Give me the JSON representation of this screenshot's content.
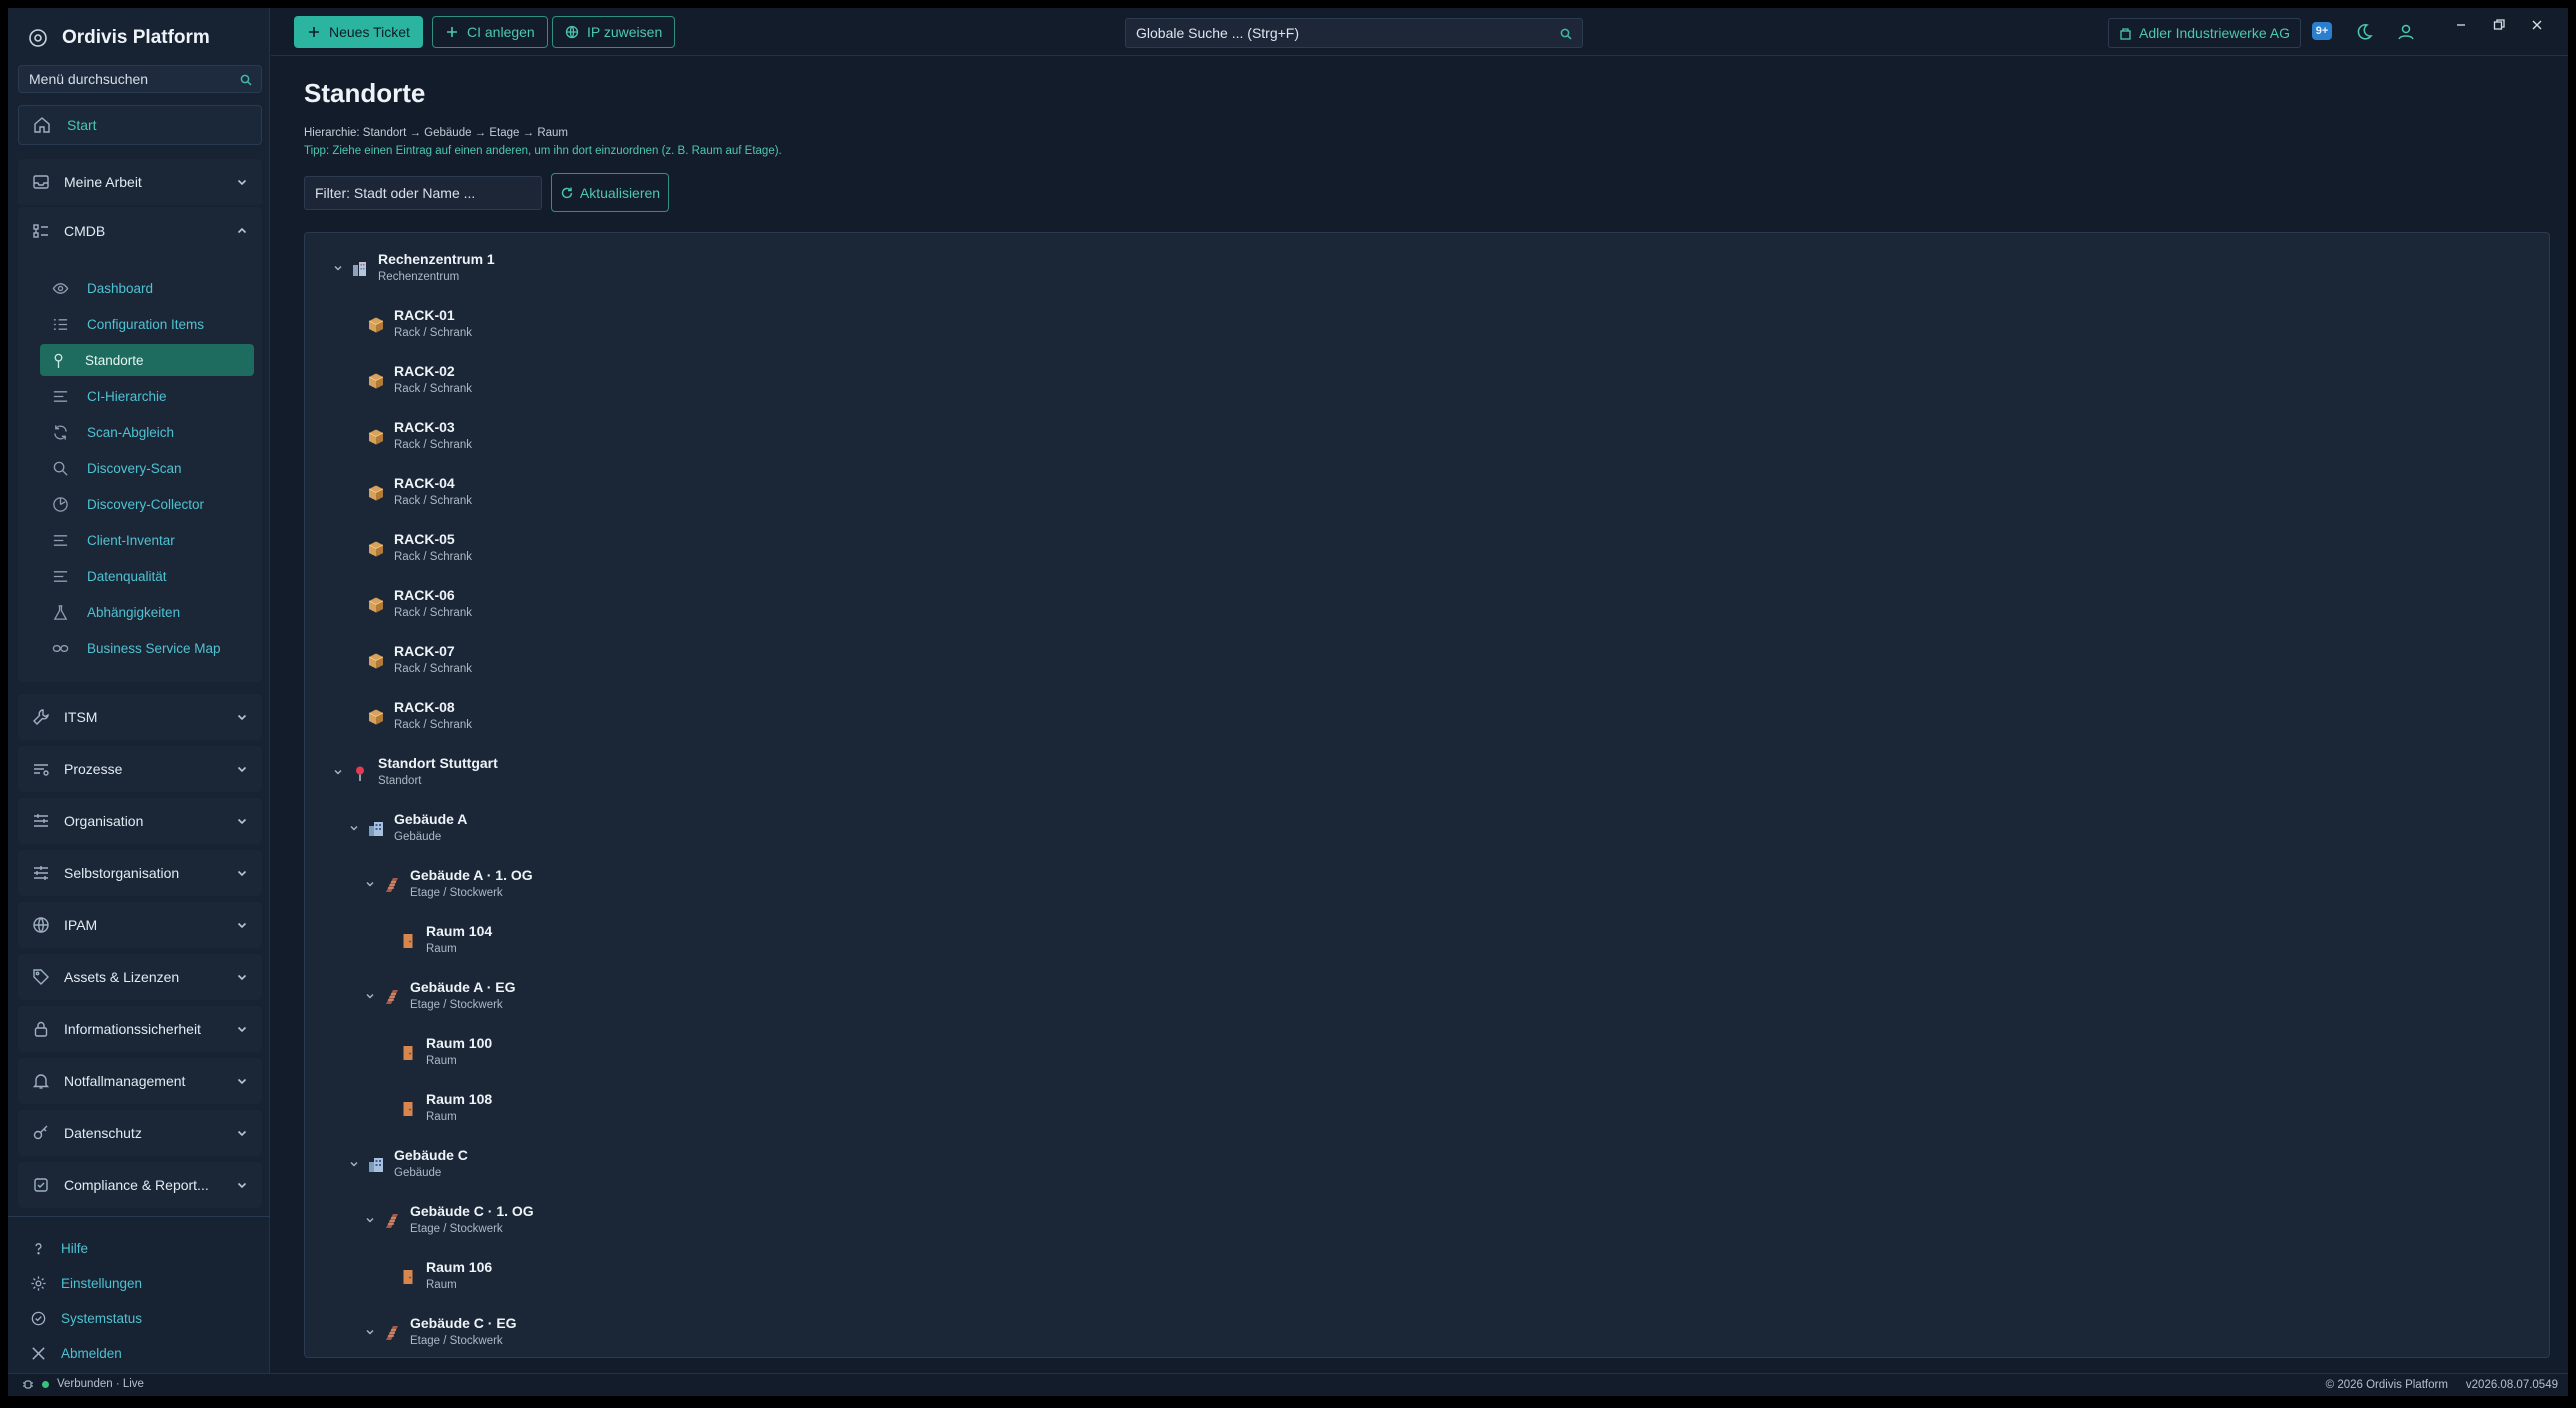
{
  "app": {
    "title": "Ordivis Platform"
  },
  "sidebar": {
    "search_placeholder": "Menü durchsuchen",
    "start": "Start",
    "groups_top": [
      {
        "label": "Meine Arbeit"
      }
    ],
    "cmdb": {
      "label": "CMDB",
      "items": [
        {
          "label": "Dashboard",
          "icon": "eye-icon"
        },
        {
          "label": "Configuration Items",
          "icon": "list-icon"
        },
        {
          "label": "Standorte",
          "icon": "pin-icon",
          "active": true
        },
        {
          "label": "CI-Hierarchie",
          "icon": "lines-icon"
        },
        {
          "label": "Scan-Abgleich",
          "icon": "sync-icon"
        },
        {
          "label": "Discovery-Scan",
          "icon": "search-icon"
        },
        {
          "label": "Discovery-Collector",
          "icon": "radar-icon"
        },
        {
          "label": "Client-Inventar",
          "icon": "lines-icon"
        },
        {
          "label": "Datenqualität",
          "icon": "lines-icon"
        },
        {
          "label": "Abhängigkeiten",
          "icon": "flask-icon"
        },
        {
          "label": "Business Service Map",
          "icon": "link-icon"
        }
      ]
    },
    "groups_bottom": [
      {
        "label": "ITSM",
        "icon": "wrench-icon"
      },
      {
        "label": "Prozesse",
        "icon": "process-icon"
      },
      {
        "label": "Organisation",
        "icon": "org-icon"
      },
      {
        "label": "Selbstorganisation",
        "icon": "kanban-icon"
      },
      {
        "label": "IPAM",
        "icon": "globe-icon"
      },
      {
        "label": "Assets & Lizenzen",
        "icon": "tag-icon"
      },
      {
        "label": "Informationssicherheit",
        "icon": "lock-icon"
      },
      {
        "label": "Notfallmanagement",
        "icon": "bell-icon"
      },
      {
        "label": "Datenschutz",
        "icon": "key-icon"
      },
      {
        "label": "Compliance & Report...",
        "icon": "checkshield-icon"
      }
    ],
    "footer": [
      {
        "label": "Hilfe",
        "icon": "help-icon"
      },
      {
        "label": "Einstellungen",
        "icon": "gear-icon"
      },
      {
        "label": "Systemstatus",
        "icon": "status-icon"
      },
      {
        "label": "Abmelden",
        "icon": "close-icon"
      }
    ]
  },
  "topbar": {
    "new_ticket": "Neues Ticket",
    "ci_create": "CI anlegen",
    "ip_assign": "IP zuweisen",
    "search_placeholder": "Globale Suche ... (Strg+F)",
    "tenant": "Adler Industriewerke AG",
    "badge": "9+"
  },
  "page": {
    "title": "Standorte",
    "hierarchy": "Hierarchie: Standort → Gebäude → Etage → Raum",
    "tip": "Tipp: Ziehe einen Eintrag auf einen anderen, um ihn dort einzuordnen (z. B. Raum auf Etage).",
    "filter_placeholder": "Filter: Stadt oder Name ...",
    "refresh": "Aktualisieren"
  },
  "tree": [
    {
      "title": "Rechenzentrum 1",
      "subtitle": "Rechenzentrum",
      "level": 0,
      "kind": "datacenter",
      "expanded": true
    },
    {
      "title": "RACK-01",
      "subtitle": "Rack / Schrank",
      "level": 1,
      "kind": "rack"
    },
    {
      "title": "RACK-02",
      "subtitle": "Rack / Schrank",
      "level": 1,
      "kind": "rack"
    },
    {
      "title": "RACK-03",
      "subtitle": "Rack / Schrank",
      "level": 1,
      "kind": "rack"
    },
    {
      "title": "RACK-04",
      "subtitle": "Rack / Schrank",
      "level": 1,
      "kind": "rack"
    },
    {
      "title": "RACK-05",
      "subtitle": "Rack / Schrank",
      "level": 1,
      "kind": "rack"
    },
    {
      "title": "RACK-06",
      "subtitle": "Rack / Schrank",
      "level": 1,
      "kind": "rack"
    },
    {
      "title": "RACK-07",
      "subtitle": "Rack / Schrank",
      "level": 1,
      "kind": "rack"
    },
    {
      "title": "RACK-08",
      "subtitle": "Rack / Schrank",
      "level": 1,
      "kind": "rack"
    },
    {
      "title": "Standort Stuttgart",
      "subtitle": "Standort",
      "level": 0,
      "kind": "site",
      "expanded": true
    },
    {
      "title": "Gebäude A",
      "subtitle": "Gebäude",
      "level": 1,
      "kind": "building",
      "expanded": true
    },
    {
      "title": "Gebäude A · 1. OG",
      "subtitle": "Etage / Stockwerk",
      "level": 2,
      "kind": "floor",
      "expanded": true
    },
    {
      "title": "Raum 104",
      "subtitle": "Raum",
      "level": 3,
      "kind": "room"
    },
    {
      "title": "Gebäude A · EG",
      "subtitle": "Etage / Stockwerk",
      "level": 2,
      "kind": "floor",
      "expanded": true
    },
    {
      "title": "Raum 100",
      "subtitle": "Raum",
      "level": 3,
      "kind": "room"
    },
    {
      "title": "Raum 108",
      "subtitle": "Raum",
      "level": 3,
      "kind": "room"
    },
    {
      "title": "Gebäude C",
      "subtitle": "Gebäude",
      "level": 1,
      "kind": "building",
      "expanded": true
    },
    {
      "title": "Gebäude C · 1. OG",
      "subtitle": "Etage / Stockwerk",
      "level": 2,
      "kind": "floor",
      "expanded": true
    },
    {
      "title": "Raum 106",
      "subtitle": "Raum",
      "level": 3,
      "kind": "room"
    },
    {
      "title": "Gebäude C · EG",
      "subtitle": "Etage / Stockwerk",
      "level": 2,
      "kind": "floor",
      "expanded": true
    }
  ],
  "status": {
    "connection": "Verbunden · Live",
    "copyright": "© 2026 Ordivis Platform",
    "version": "v2026.08.07.0549"
  },
  "colors": {
    "accent": "#2bb5a0",
    "link": "#4fc2d2",
    "background": "#131c2b",
    "panel": "#1b2636"
  }
}
